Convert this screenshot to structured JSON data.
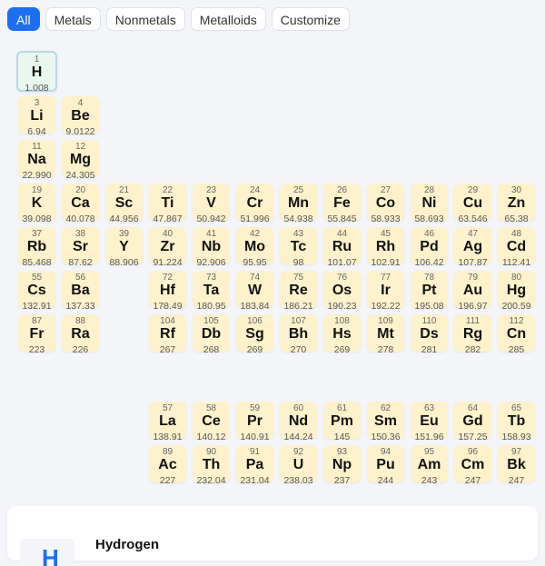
{
  "filters": [
    {
      "label": "All",
      "active": true
    },
    {
      "label": "Metals",
      "active": false
    },
    {
      "label": "Nonmetals",
      "active": false
    },
    {
      "label": "Metalloids",
      "active": false
    },
    {
      "label": "Customize",
      "active": false
    }
  ],
  "elements": [
    {
      "n": "1",
      "s": "H",
      "m": "1.008",
      "row": 0,
      "col": 0,
      "selected": true
    },
    {
      "n": "3",
      "s": "Li",
      "m": "6.94",
      "row": 1,
      "col": 0
    },
    {
      "n": "4",
      "s": "Be",
      "m": "9.0122",
      "row": 1,
      "col": 1
    },
    {
      "n": "11",
      "s": "Na",
      "m": "22.990",
      "row": 2,
      "col": 0
    },
    {
      "n": "12",
      "s": "Mg",
      "m": "24.305",
      "row": 2,
      "col": 1
    },
    {
      "n": "19",
      "s": "K",
      "m": "39.098",
      "row": 3,
      "col": 0
    },
    {
      "n": "20",
      "s": "Ca",
      "m": "40.078",
      "row": 3,
      "col": 1
    },
    {
      "n": "21",
      "s": "Sc",
      "m": "44.956",
      "row": 3,
      "col": 2
    },
    {
      "n": "22",
      "s": "Ti",
      "m": "47.867",
      "row": 3,
      "col": 3
    },
    {
      "n": "23",
      "s": "V",
      "m": "50.942",
      "row": 3,
      "col": 4
    },
    {
      "n": "24",
      "s": "Cr",
      "m": "51.996",
      "row": 3,
      "col": 5
    },
    {
      "n": "25",
      "s": "Mn",
      "m": "54.938",
      "row": 3,
      "col": 6
    },
    {
      "n": "26",
      "s": "Fe",
      "m": "55.845",
      "row": 3,
      "col": 7
    },
    {
      "n": "27",
      "s": "Co",
      "m": "58.933",
      "row": 3,
      "col": 8
    },
    {
      "n": "28",
      "s": "Ni",
      "m": "58.693",
      "row": 3,
      "col": 9
    },
    {
      "n": "29",
      "s": "Cu",
      "m": "63.546",
      "row": 3,
      "col": 10
    },
    {
      "n": "30",
      "s": "Zn",
      "m": "65.38",
      "row": 3,
      "col": 11
    },
    {
      "n": "37",
      "s": "Rb",
      "m": "85.468",
      "row": 4,
      "col": 0
    },
    {
      "n": "38",
      "s": "Sr",
      "m": "87.62",
      "row": 4,
      "col": 1
    },
    {
      "n": "39",
      "s": "Y",
      "m": "88.906",
      "row": 4,
      "col": 2
    },
    {
      "n": "40",
      "s": "Zr",
      "m": "91.224",
      "row": 4,
      "col": 3
    },
    {
      "n": "41",
      "s": "Nb",
      "m": "92.906",
      "row": 4,
      "col": 4
    },
    {
      "n": "42",
      "s": "Mo",
      "m": "95.95",
      "row": 4,
      "col": 5
    },
    {
      "n": "43",
      "s": "Tc",
      "m": "98",
      "row": 4,
      "col": 6
    },
    {
      "n": "44",
      "s": "Ru",
      "m": "101.07",
      "row": 4,
      "col": 7
    },
    {
      "n": "45",
      "s": "Rh",
      "m": "102.91",
      "row": 4,
      "col": 8
    },
    {
      "n": "46",
      "s": "Pd",
      "m": "106.42",
      "row": 4,
      "col": 9
    },
    {
      "n": "47",
      "s": "Ag",
      "m": "107.87",
      "row": 4,
      "col": 10
    },
    {
      "n": "48",
      "s": "Cd",
      "m": "112.41",
      "row": 4,
      "col": 11
    },
    {
      "n": "55",
      "s": "Cs",
      "m": "132.91",
      "row": 5,
      "col": 0
    },
    {
      "n": "56",
      "s": "Ba",
      "m": "137.33",
      "row": 5,
      "col": 1
    },
    {
      "n": "72",
      "s": "Hf",
      "m": "178.49",
      "row": 5,
      "col": 3
    },
    {
      "n": "73",
      "s": "Ta",
      "m": "180.95",
      "row": 5,
      "col": 4
    },
    {
      "n": "74",
      "s": "W",
      "m": "183.84",
      "row": 5,
      "col": 5
    },
    {
      "n": "75",
      "s": "Re",
      "m": "186.21",
      "row": 5,
      "col": 6
    },
    {
      "n": "76",
      "s": "Os",
      "m": "190.23",
      "row": 5,
      "col": 7
    },
    {
      "n": "77",
      "s": "Ir",
      "m": "192.22",
      "row": 5,
      "col": 8
    },
    {
      "n": "78",
      "s": "Pt",
      "m": "195.08",
      "row": 5,
      "col": 9
    },
    {
      "n": "79",
      "s": "Au",
      "m": "196.97",
      "row": 5,
      "col": 10
    },
    {
      "n": "80",
      "s": "Hg",
      "m": "200.59",
      "row": 5,
      "col": 11
    },
    {
      "n": "87",
      "s": "Fr",
      "m": "223",
      "row": 6,
      "col": 0
    },
    {
      "n": "88",
      "s": "Ra",
      "m": "226",
      "row": 6,
      "col": 1
    },
    {
      "n": "104",
      "s": "Rf",
      "m": "267",
      "row": 6,
      "col": 3
    },
    {
      "n": "105",
      "s": "Db",
      "m": "268",
      "row": 6,
      "col": 4
    },
    {
      "n": "106",
      "s": "Sg",
      "m": "269",
      "row": 6,
      "col": 5
    },
    {
      "n": "107",
      "s": "Bh",
      "m": "270",
      "row": 6,
      "col": 6
    },
    {
      "n": "108",
      "s": "Hs",
      "m": "269",
      "row": 6,
      "col": 7
    },
    {
      "n": "109",
      "s": "Mt",
      "m": "278",
      "row": 6,
      "col": 8
    },
    {
      "n": "110",
      "s": "Ds",
      "m": "281",
      "row": 6,
      "col": 9
    },
    {
      "n": "111",
      "s": "Rg",
      "m": "282",
      "row": 6,
      "col": 10
    },
    {
      "n": "112",
      "s": "Cn",
      "m": "285",
      "row": 6,
      "col": 11
    },
    {
      "n": "57",
      "s": "La",
      "m": "138.91",
      "row": 8,
      "col": 3
    },
    {
      "n": "58",
      "s": "Ce",
      "m": "140.12",
      "row": 8,
      "col": 4
    },
    {
      "n": "59",
      "s": "Pr",
      "m": "140.91",
      "row": 8,
      "col": 5
    },
    {
      "n": "60",
      "s": "Nd",
      "m": "144.24",
      "row": 8,
      "col": 6
    },
    {
      "n": "61",
      "s": "Pm",
      "m": "145",
      "row": 8,
      "col": 7
    },
    {
      "n": "62",
      "s": "Sm",
      "m": "150.36",
      "row": 8,
      "col": 8
    },
    {
      "n": "63",
      "s": "Eu",
      "m": "151.96",
      "row": 8,
      "col": 9
    },
    {
      "n": "64",
      "s": "Gd",
      "m": "157.25",
      "row": 8,
      "col": 10
    },
    {
      "n": "65",
      "s": "Tb",
      "m": "158.93",
      "row": 8,
      "col": 11
    },
    {
      "n": "89",
      "s": "Ac",
      "m": "227",
      "row": 9,
      "col": 3
    },
    {
      "n": "90",
      "s": "Th",
      "m": "232.04",
      "row": 9,
      "col": 4
    },
    {
      "n": "91",
      "s": "Pa",
      "m": "231.04",
      "row": 9,
      "col": 5
    },
    {
      "n": "92",
      "s": "U",
      "m": "238.03",
      "row": 9,
      "col": 6
    },
    {
      "n": "93",
      "s": "Np",
      "m": "237",
      "row": 9,
      "col": 7
    },
    {
      "n": "94",
      "s": "Pu",
      "m": "244",
      "row": 9,
      "col": 8
    },
    {
      "n": "95",
      "s": "Am",
      "m": "243",
      "row": 9,
      "col": 9
    },
    {
      "n": "96",
      "s": "Cm",
      "m": "247",
      "row": 9,
      "col": 10
    },
    {
      "n": "97",
      "s": "Bk",
      "m": "247",
      "row": 9,
      "col": 11
    }
  ],
  "detail": {
    "symbol": "H",
    "name": "Hydrogen"
  },
  "colors": {
    "accent": "#1d6ff2",
    "tile": "#fdf2cc",
    "selected_tile": "#e9f8ef"
  }
}
